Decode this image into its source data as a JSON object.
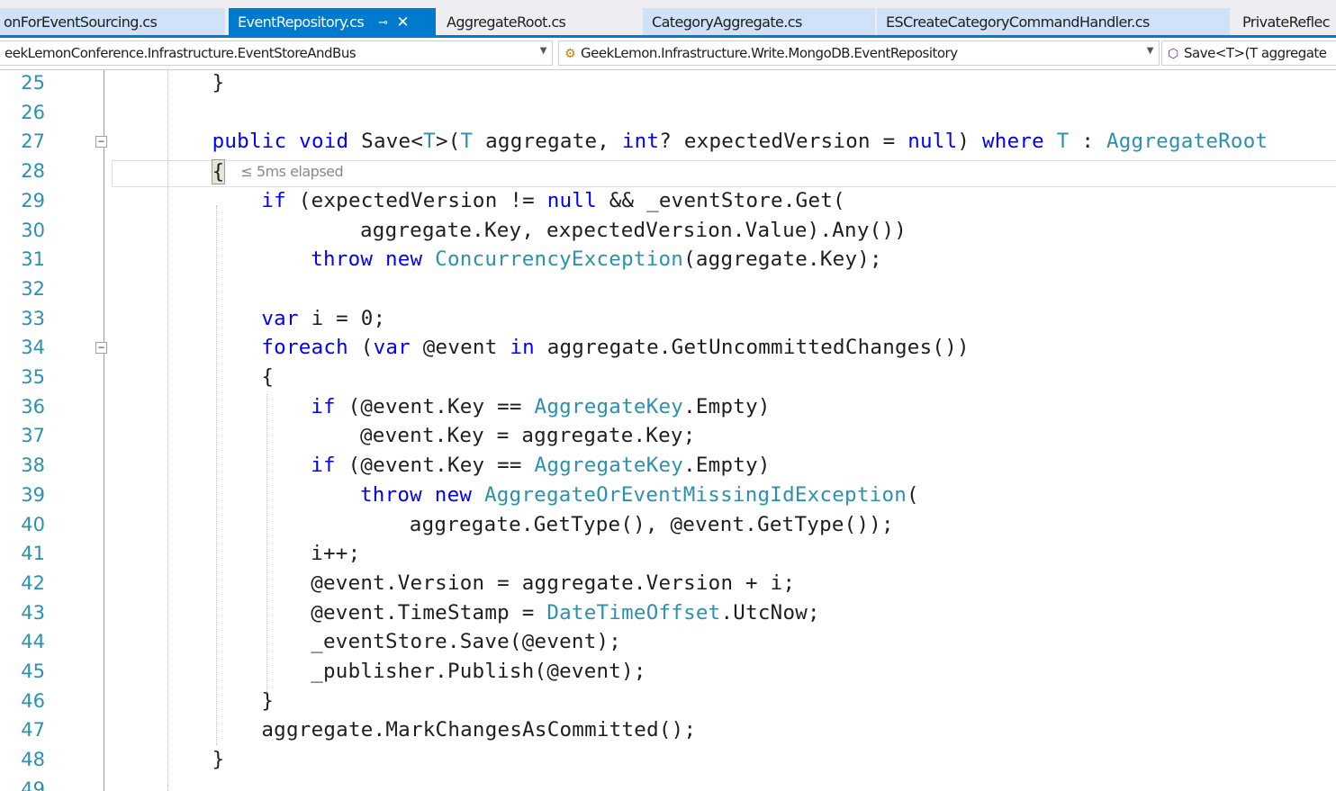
{
  "tabs": [
    {
      "label": "onForEventSourcing.cs",
      "state": "preview"
    },
    {
      "label": "EventRepository.cs",
      "state": "active",
      "pin": "⊸",
      "close": "✕"
    },
    {
      "label": "AggregateRoot.cs",
      "state": "inactive"
    },
    {
      "label": "CategoryAggregate.cs",
      "state": "inactive"
    },
    {
      "label": "ESCreateCategoryCommandHandler.cs",
      "state": "inactive"
    },
    {
      "label": "PrivateReflec",
      "state": "inactive"
    }
  ],
  "navbar": {
    "project": "eekLemonConference.Infrastructure.EventStoreAndBus",
    "type": "GeekLemon.Infrastructure.Write.MongoDB.EventRepository",
    "member": "Save<T>(T aggregate"
  },
  "colors": {
    "keyword": "#0000ff",
    "type": "#2b91af",
    "line_number": "#2b91af",
    "accent": "#007acc"
  },
  "editor": {
    "perf_hint": "≤ 5ms elapsed",
    "lines": [
      {
        "n": "25",
        "indent": 8,
        "parts": [
          [
            "}",
            ""
          ]
        ]
      },
      {
        "n": "26",
        "indent": 0,
        "parts": []
      },
      {
        "n": "27",
        "indent": 8,
        "fold": "−",
        "parts": [
          [
            "public",
            "kw"
          ],
          [
            " ",
            ""
          ],
          [
            "void",
            "kw"
          ],
          [
            " Save<",
            ""
          ],
          [
            "T",
            "ty"
          ],
          [
            ">(",
            ""
          ],
          [
            "T",
            "ty"
          ],
          [
            " aggregate, ",
            ""
          ],
          [
            "int",
            "kw"
          ],
          [
            "? expectedVersion = ",
            ""
          ],
          [
            "null",
            "kw"
          ],
          [
            ") ",
            ""
          ],
          [
            "where",
            "kw"
          ],
          [
            " ",
            ""
          ],
          [
            "T",
            "ty"
          ],
          [
            " : ",
            ""
          ],
          [
            "AggregateRoot",
            "ty"
          ]
        ]
      },
      {
        "n": "28",
        "indent": 8,
        "parts": [
          [
            "{",
            "brace"
          ]
        ]
      },
      {
        "n": "29",
        "indent": 12,
        "parts": [
          [
            "if",
            "kw"
          ],
          [
            " (expectedVersion != ",
            ""
          ],
          [
            "null",
            "kw"
          ],
          [
            " && _eventStore.Get(",
            ""
          ]
        ]
      },
      {
        "n": "30",
        "indent": 20,
        "parts": [
          [
            "aggregate.Key, expectedVersion.Value).Any())",
            ""
          ]
        ]
      },
      {
        "n": "31",
        "indent": 16,
        "parts": [
          [
            "throw",
            "kw"
          ],
          [
            " ",
            ""
          ],
          [
            "new",
            "kw"
          ],
          [
            " ",
            ""
          ],
          [
            "ConcurrencyException",
            "ty"
          ],
          [
            "(aggregate.Key);",
            ""
          ]
        ]
      },
      {
        "n": "32",
        "indent": 0,
        "parts": []
      },
      {
        "n": "33",
        "indent": 12,
        "parts": [
          [
            "var",
            "kw"
          ],
          [
            " i = 0;",
            ""
          ]
        ]
      },
      {
        "n": "34",
        "indent": 12,
        "fold": "−",
        "parts": [
          [
            "foreach",
            "kw"
          ],
          [
            " (",
            ""
          ],
          [
            "var",
            "kw"
          ],
          [
            " @event ",
            ""
          ],
          [
            "in",
            "kw"
          ],
          [
            " aggregate.GetUncommittedChanges())",
            ""
          ]
        ]
      },
      {
        "n": "35",
        "indent": 12,
        "parts": [
          [
            "{",
            ""
          ]
        ]
      },
      {
        "n": "36",
        "indent": 16,
        "parts": [
          [
            "if",
            "kw"
          ],
          [
            " (@event.Key == ",
            ""
          ],
          [
            "AggregateKey",
            "ty"
          ],
          [
            ".Empty)",
            ""
          ]
        ]
      },
      {
        "n": "37",
        "indent": 20,
        "parts": [
          [
            "@event.Key = aggregate.Key;",
            ""
          ]
        ]
      },
      {
        "n": "38",
        "indent": 16,
        "parts": [
          [
            "if",
            "kw"
          ],
          [
            " (@event.Key == ",
            ""
          ],
          [
            "AggregateKey",
            "ty"
          ],
          [
            ".Empty)",
            ""
          ]
        ]
      },
      {
        "n": "39",
        "indent": 20,
        "parts": [
          [
            "throw",
            "kw"
          ],
          [
            " ",
            ""
          ],
          [
            "new",
            "kw"
          ],
          [
            " ",
            ""
          ],
          [
            "AggregateOrEventMissingIdException",
            "ty"
          ],
          [
            "(",
            ""
          ]
        ]
      },
      {
        "n": "40",
        "indent": 24,
        "parts": [
          [
            "aggregate.GetType(), @event.GetType());",
            ""
          ]
        ]
      },
      {
        "n": "41",
        "indent": 16,
        "parts": [
          [
            "i++;",
            ""
          ]
        ]
      },
      {
        "n": "42",
        "indent": 16,
        "parts": [
          [
            "@event.Version = aggregate.Version + i;",
            ""
          ]
        ]
      },
      {
        "n": "43",
        "indent": 16,
        "parts": [
          [
            "@event.TimeStamp = ",
            ""
          ],
          [
            "DateTimeOffset",
            "ty"
          ],
          [
            ".UtcNow;",
            ""
          ]
        ]
      },
      {
        "n": "44",
        "indent": 16,
        "parts": [
          [
            "_eventStore.Save(@event);",
            ""
          ]
        ]
      },
      {
        "n": "45",
        "indent": 16,
        "parts": [
          [
            "_publisher.Publish(@event);",
            ""
          ]
        ]
      },
      {
        "n": "46",
        "indent": 12,
        "parts": [
          [
            "}",
            ""
          ]
        ]
      },
      {
        "n": "47",
        "indent": 12,
        "parts": [
          [
            "aggregate.MarkChangesAsCommitted();",
            ""
          ]
        ]
      },
      {
        "n": "48",
        "indent": 8,
        "parts": [
          [
            "}",
            ""
          ]
        ]
      },
      {
        "n": "49",
        "indent": 0,
        "parts": []
      }
    ]
  }
}
